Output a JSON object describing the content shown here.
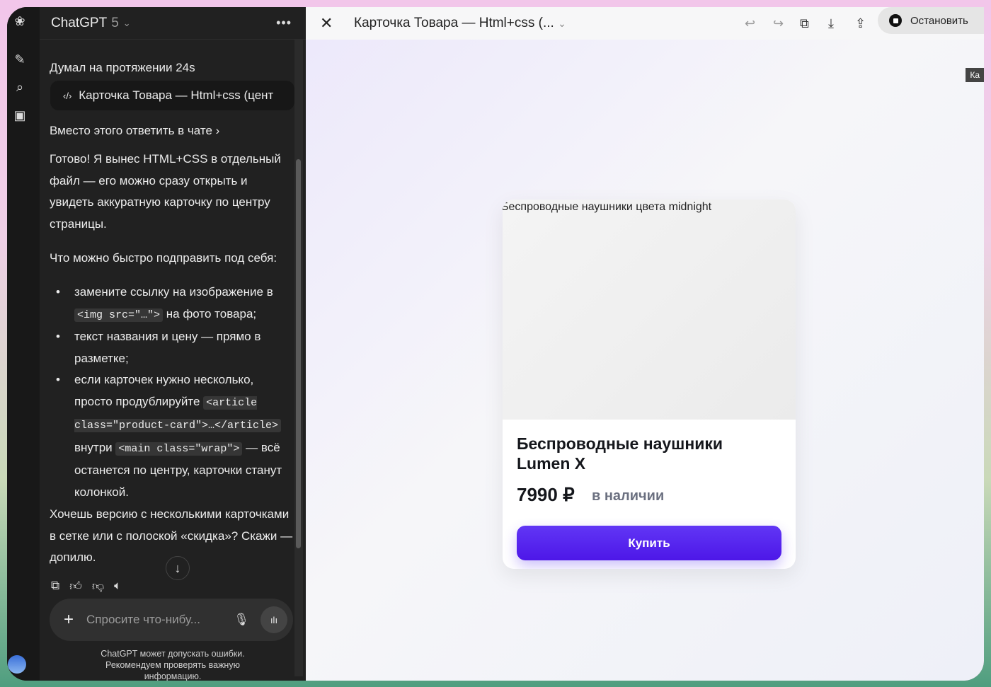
{
  "chat": {
    "model": "ChatGPT",
    "version": "5",
    "thought": "Думал на протяжении 24s",
    "artifact": "Карточка Товара — Html+css (цент",
    "reply_in_chat": "Вместо этого ответить в чате",
    "p1": "Готово! Я вынес HTML+CSS в отдельный файл — его можно сразу открыть и увидеть аккуратную карточку по центру страницы.",
    "p2": "Что можно быстро подправить под себя:",
    "b1a": "замените ссылку на изображение в ",
    "b1code": "<img src=\"…\">",
    "b1b": " на фото товара;",
    "b2": "текст названия и цену — прямо в разметке;",
    "b3a": "если карточек нужно несколько, просто продублируйте ",
    "b3code1": "<article class=\"product-card\">…</article>",
    "b3b": " внутри ",
    "b3code2": "<main class=\"wrap\">",
    "b3c": " — всё останется по центру, карточки станут колонкой.",
    "p3": "Хочешь версию с несколькими карточками в сетке или с полоской «скидка»? Скажи — допилю.",
    "placeholder": "Спросите что-нибу...",
    "disclaimer": "ChatGPT может допускать ошибки. Рекомендуем проверять важную информацию."
  },
  "canvas": {
    "title": "Карточка Товара — Html+css (...",
    "stop": "Остановить",
    "tooltip": "Ка"
  },
  "product": {
    "img_alt": "Беспроводные наушники цвета midnight",
    "name": "Беспроводные наушники Lumen X",
    "price": "7990 ₽",
    "stock": "в наличии",
    "buy": "Купить",
    "accent": "#5424ef"
  }
}
